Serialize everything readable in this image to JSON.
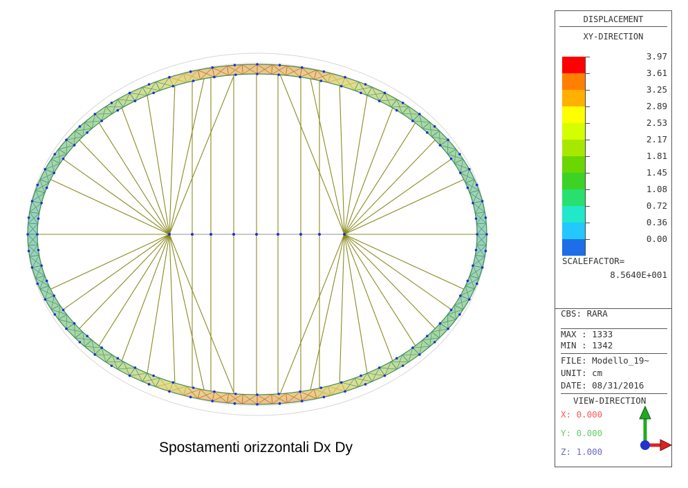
{
  "panel": {
    "title": "DISPLACEMENT",
    "subtitle": "XY-DIRECTION",
    "legend_values": [
      "3.97",
      "3.61",
      "3.25",
      "2.89",
      "2.53",
      "2.17",
      "1.81",
      "1.45",
      "1.08",
      "0.72",
      "0.36",
      "0.00"
    ],
    "legend_colors": [
      "#ff0000",
      "#ff7f00",
      "#ffb000",
      "#ffff00",
      "#d4ff00",
      "#a8e800",
      "#6cd600",
      "#3cd226",
      "#28e070",
      "#20e8c8",
      "#22c8ff",
      "#1e6ee8"
    ],
    "scalefactor_label": "SCALEFACTOR=",
    "scalefactor_value": "8.5640E+001",
    "cbs": "CBS: RARA",
    "max": "MAX : 1333",
    "min": "MIN : 1342",
    "file": "FILE: Modello_19~",
    "unit": "UNIT: cm",
    "date": "DATE: 08/31/2016",
    "view_direction_title": "VIEW-DIRECTION",
    "view_x": "X: 0.000",
    "view_y": "Y: 0.000",
    "view_z": "Z: 1.000"
  },
  "caption": "Spostamenti orizzontali Dx Dy",
  "colors": {
    "axis_x": "#ff5555",
    "axis_y": "#66dd66",
    "axis_z": "#6666cc",
    "node": "#1a2fd6",
    "spoke": "#8a8a20"
  }
}
